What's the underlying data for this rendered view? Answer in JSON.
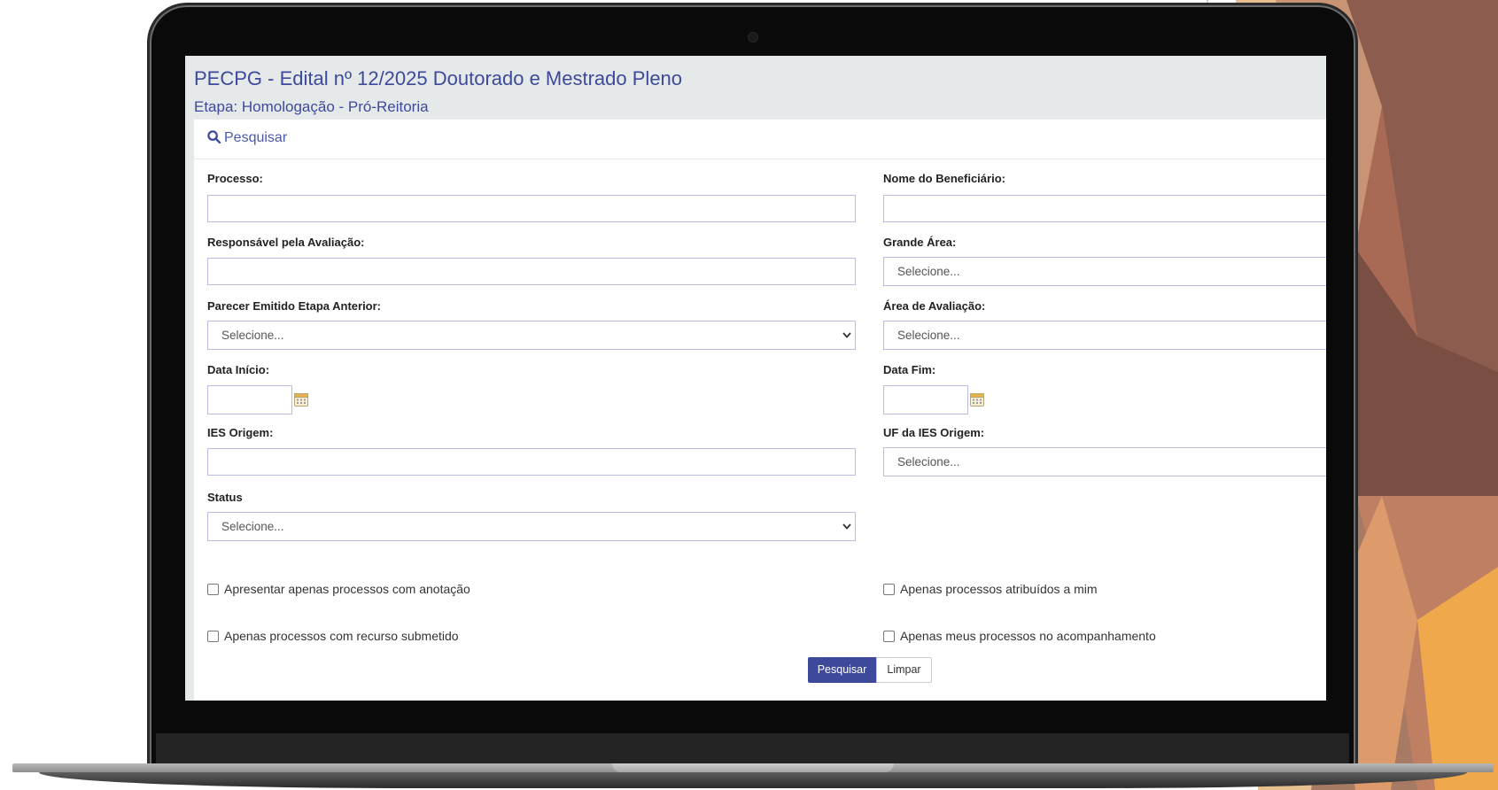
{
  "header": {
    "title": "PECPG - Edital nº 12/2025 Doutorado e Mestrado Pleno",
    "subtitle": "Etapa: Homologação - Pró-Reitoria"
  },
  "search_panel": {
    "heading": "Pesquisar",
    "heading_icon": "search-icon"
  },
  "form": {
    "processo_label": "Processo:",
    "processo_value": "",
    "beneficiario_label": "Nome do Beneficiário:",
    "beneficiario_value": "",
    "responsavel_label": "Responsável pela Avaliação:",
    "responsavel_value": "",
    "grande_area_label": "Grande Área:",
    "grande_area_value": "Selecione...",
    "parecer_label": "Parecer Emitido Etapa Anterior:",
    "parecer_value": "Selecione...",
    "area_avaliacao_label": "Área de Avaliação:",
    "area_avaliacao_value": "Selecione...",
    "data_inicio_label": "Data Início:",
    "data_inicio_value": "",
    "data_fim_label": "Data Fim:",
    "data_fim_value": "",
    "ies_origem_label": "IES Origem:",
    "ies_origem_value": "",
    "uf_ies_label": "UF da IES Origem:",
    "uf_ies_value": "Selecione...",
    "status_label": "Status",
    "status_value": "Selecione..."
  },
  "checkboxes": {
    "anotacao": {
      "label": "Apresentar apenas processos com anotação",
      "checked": false
    },
    "atribuidos": {
      "label": "Apenas processos atribuídos a mim",
      "checked": false
    },
    "recurso": {
      "label": "Apenas processos com recurso submetido",
      "checked": false
    },
    "acompanhamento": {
      "label": "Apenas meus processos no acompanhamento",
      "checked": false
    }
  },
  "buttons": {
    "search_label": "Pesquisar",
    "clear_label": "Limpar"
  },
  "colors": {
    "accent": "#3d4a9b",
    "header_bg": "#e6e9ea",
    "input_border": "#b9bde3"
  }
}
